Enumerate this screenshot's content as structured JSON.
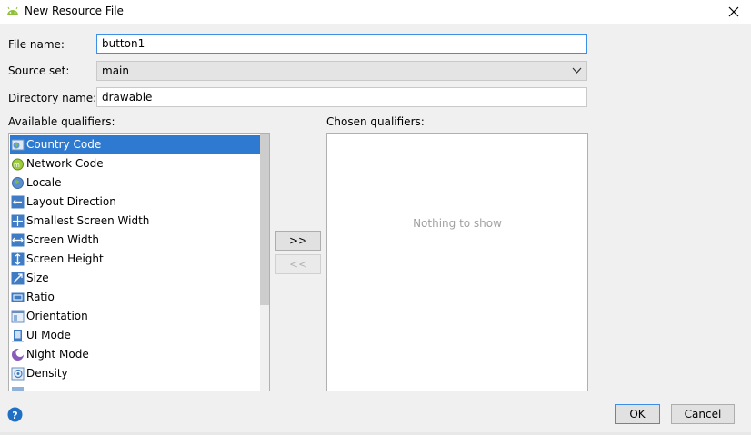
{
  "window": {
    "title": "New Resource File",
    "app_icon": "android-icon",
    "close_icon": "close-icon"
  },
  "form": {
    "file_name": {
      "label": "File name:",
      "value": "button1"
    },
    "source_set": {
      "label": "Source set:",
      "value": "main"
    },
    "directory_name": {
      "label": "Directory name:",
      "value": "drawable"
    }
  },
  "available": {
    "label": "Available qualifiers:",
    "items": [
      {
        "label": "Country Code",
        "icon": "country-code-icon",
        "selected": true
      },
      {
        "label": "Network Code",
        "icon": "network-code-icon"
      },
      {
        "label": "Locale",
        "icon": "globe-icon"
      },
      {
        "label": "Layout Direction",
        "icon": "layout-direction-icon"
      },
      {
        "label": "Smallest Screen Width",
        "icon": "smallest-width-icon"
      },
      {
        "label": "Screen Width",
        "icon": "screen-width-icon"
      },
      {
        "label": "Screen Height",
        "icon": "screen-height-icon"
      },
      {
        "label": "Size",
        "icon": "size-icon"
      },
      {
        "label": "Ratio",
        "icon": "ratio-icon"
      },
      {
        "label": "Orientation",
        "icon": "orientation-icon"
      },
      {
        "label": "UI Mode",
        "icon": "ui-mode-icon"
      },
      {
        "label": "Night Mode",
        "icon": "night-mode-icon"
      },
      {
        "label": "Density",
        "icon": "density-icon"
      }
    ]
  },
  "transfer": {
    "add_label": ">>",
    "remove_label": "<<"
  },
  "chosen": {
    "label": "Chosen qualifiers:",
    "empty_text": "Nothing to show"
  },
  "footer": {
    "ok_label": "OK",
    "cancel_label": "Cancel",
    "help_icon": "help-icon"
  },
  "colors": {
    "selection": "#2e7ad1",
    "focus_border": "#3d8ee6",
    "help": "#1f6fc5"
  }
}
